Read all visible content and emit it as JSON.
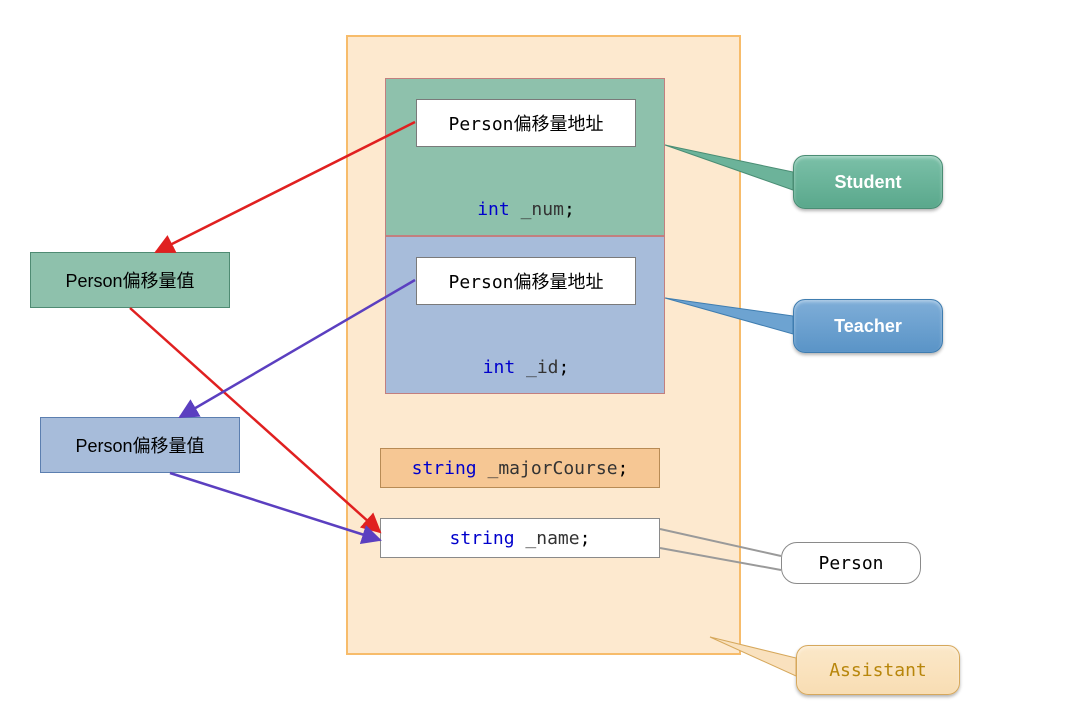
{
  "diagram": {
    "offset_value_green": "Person偏移量值",
    "offset_value_blue": "Person偏移量值",
    "student": {
      "offset_addr": "Person偏移量地址",
      "field_type": "int",
      "field_name": "_num",
      "semicolon": ";"
    },
    "teacher": {
      "offset_addr": "Person偏移量地址",
      "field_type": "int",
      "field_name": "_id",
      "semicolon": ";"
    },
    "major": {
      "type": "string",
      "name": "_majorCourse",
      "semicolon": ";"
    },
    "name_field": {
      "type": "string",
      "name": "_name",
      "semicolon": ";"
    },
    "callouts": {
      "student": "Student",
      "teacher": "Teacher",
      "person": "Person",
      "assistant": "Assistant"
    }
  }
}
